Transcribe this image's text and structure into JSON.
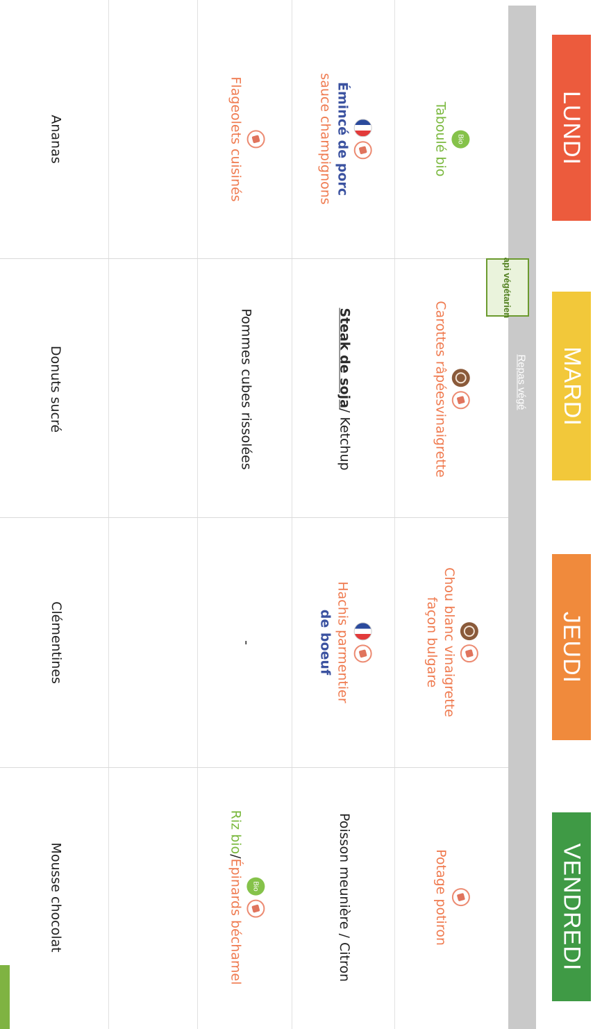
{
  "days": [
    {
      "label": "LUNDI",
      "color": "#ec5b3d"
    },
    {
      "label": "MARDI",
      "color": "#f2c83a"
    },
    {
      "label": "JEUDI",
      "color": "#f08a3c"
    },
    {
      "label": "VENDREDI",
      "color": "#3f9a45"
    }
  ],
  "badges": {
    "api": "api végétarien",
    "repas_vege": "Repas végé"
  },
  "lundi": {
    "entree": "Taboulé bio",
    "plat_line1": "Émincé de porc",
    "plat_line2": "sauce champignons",
    "accompagnement": "Flageolets cuisinés",
    "dessert": "Ananas",
    "bio_label": "Bio"
  },
  "mardi": {
    "entree_part1": "Carottes râpées",
    "entree_part2": " vinaigrette",
    "plat_part1": "Steak de soja",
    "plat_part2": " / Ketchup",
    "accompagnement": "Pommes cubes rissolées",
    "dessert": "Donuts sucré"
  },
  "jeudi": {
    "entree_line1": "Chou blanc vinaigrette",
    "entree_line2": "façon bulgare",
    "plat_line1": "Hachis parmentier",
    "plat_line2": "de boeuf",
    "accompagnement": "-",
    "dessert": "Clémentines"
  },
  "vendredi": {
    "entree": "Potage potiron",
    "plat": "Poisson meunière / Citron",
    "accomp_part1": "Riz bio",
    "accomp_sep": " / ",
    "accomp_part2": "Épinards béchamel",
    "dessert": "Mousse chocolat",
    "bio_label": "Bio"
  },
  "icons": {
    "bio": "bio-icon",
    "homemade": "homemade-icon",
    "seasonal": "seasonal-icon",
    "france": "france-origin-icon"
  }
}
